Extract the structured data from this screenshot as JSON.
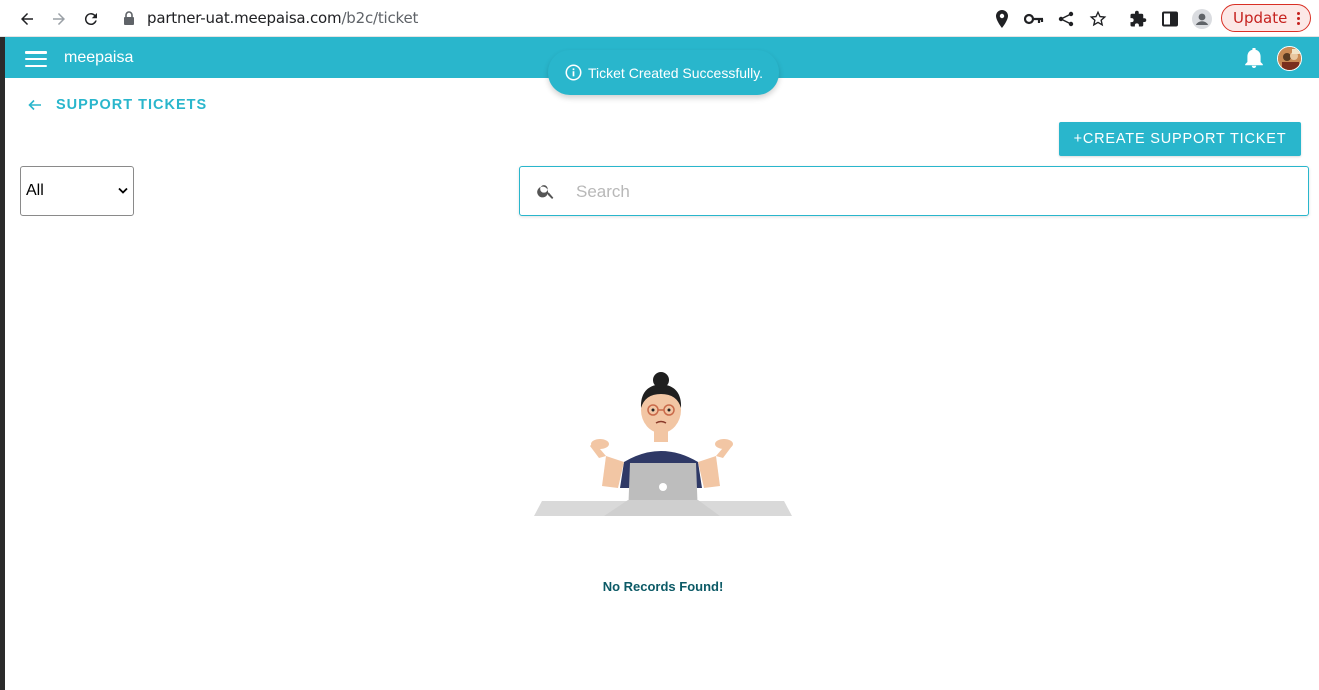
{
  "browser": {
    "url_host": "partner-uat.meepaisa.com",
    "url_path": "/b2c/ticket",
    "update_label": "Update",
    "icons": [
      "back-arrow-icon",
      "forward-arrow-icon",
      "reload-icon",
      "lock-icon",
      "location-icon",
      "key-icon",
      "share-icon",
      "star-icon",
      "extensions-icon",
      "side-panel-icon",
      "profile-icon",
      "more-vert-icon"
    ]
  },
  "appbar": {
    "brand": "meepaisa",
    "color": "#29b6cc"
  },
  "toast": {
    "message": "Ticket Created Successfully."
  },
  "page": {
    "back_label": "SUPPORT TICKETS",
    "create_button_label": "+CREATE SUPPORT TICKET",
    "filter_value": "All",
    "search_placeholder": "Search",
    "empty_message": "No Records Found!"
  }
}
